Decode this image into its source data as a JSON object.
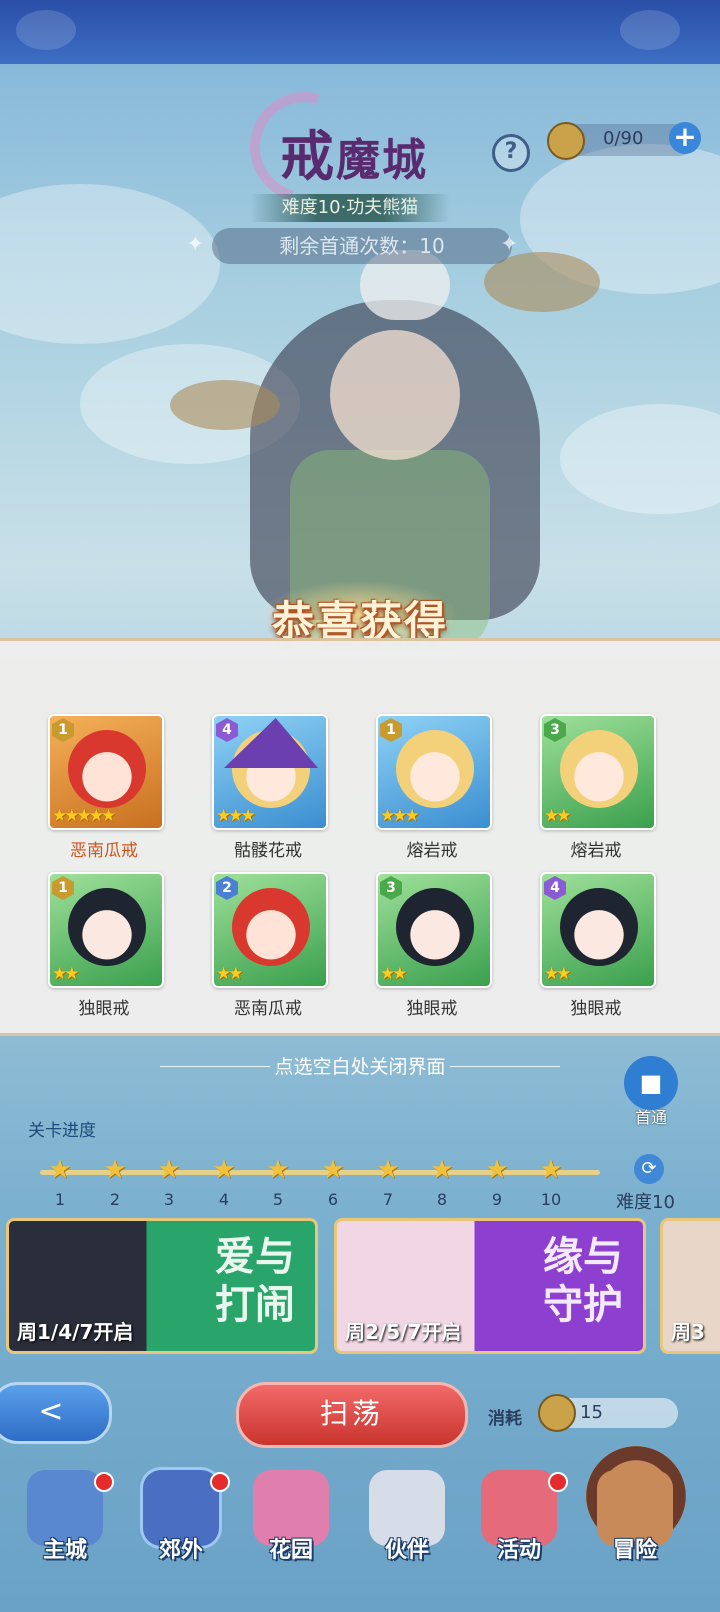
{
  "header": {
    "title_first": "戒",
    "title_rest": "魔城",
    "help_icon": "?",
    "stamina": "0/90",
    "stamina_plus": "+"
  },
  "stage": {
    "difficulty_label": "难度10·功夫熊猫",
    "remain_first_clears": "剩余首通次数：10"
  },
  "reward": {
    "banner": "恭喜获得",
    "items": [
      {
        "name": "恶南瓜戒",
        "level": "1",
        "stars": 5,
        "frame": "orange",
        "portrait": "red-demon-girl",
        "badge": "gold"
      },
      {
        "name": "骷髅花戒",
        "level": "4",
        "stars": 3,
        "frame": "blue",
        "portrait": "blonde-witch",
        "badge": "purple"
      },
      {
        "name": "熔岩戒",
        "level": "1",
        "stars": 3,
        "frame": "blue",
        "portrait": "blonde-girl",
        "badge": "gold"
      },
      {
        "name": "熔岩戒",
        "level": "3",
        "stars": 2,
        "frame": "green",
        "portrait": "blonde-girl",
        "badge": "green"
      },
      {
        "name": "独眼戒",
        "level": "1",
        "stars": 2,
        "frame": "green",
        "portrait": "black-hair-eyepatch",
        "badge": "gold"
      },
      {
        "name": "恶南瓜戒",
        "level": "2",
        "stars": 2,
        "frame": "green",
        "portrait": "red-demon-girl",
        "badge": "blue"
      },
      {
        "name": "独眼戒",
        "level": "3",
        "stars": 2,
        "frame": "green",
        "portrait": "black-hair-eyepatch",
        "badge": "green"
      },
      {
        "name": "独眼戒",
        "level": "4",
        "stars": 2,
        "frame": "green",
        "portrait": "black-hair-eyepatch",
        "badge": "purple"
      }
    ],
    "close_hint": "点选空白处关闭界面"
  },
  "side": {
    "first_clear_video": "首通"
  },
  "progress": {
    "label": "关卡进度",
    "nodes": [
      "1",
      "2",
      "3",
      "4",
      "5",
      "6",
      "7",
      "8",
      "9",
      "10"
    ],
    "difficulty": "难度10"
  },
  "events": [
    {
      "caption": "周1/4/7开启",
      "logo_line1": "爱与",
      "logo_line2": "打闹"
    },
    {
      "caption": "周2/5/7开启",
      "logo_line1": "缘与",
      "logo_line2": "守护"
    },
    {
      "caption": "周3"
    }
  ],
  "actions": {
    "back_icon": "<",
    "sweep": "扫荡",
    "cost_label": "消耗",
    "cost_value": "15"
  },
  "nav": [
    {
      "label": "主城",
      "icon": "castle-icon",
      "color": "#5a88d0",
      "dot": true
    },
    {
      "label": "郊外",
      "icon": "star-gate-icon",
      "color": "#4a6ec2",
      "dot": true
    },
    {
      "label": "花园",
      "icon": "heart-garden-icon",
      "color": "#e07fae",
      "dot": false
    },
    {
      "label": "伙伴",
      "icon": "partner-icon",
      "color": "#d6dce8",
      "dot": false
    },
    {
      "label": "活动",
      "icon": "gift-icon",
      "color": "#e56a7a",
      "dot": true
    },
    {
      "label": "冒险",
      "icon": "compass-icon",
      "color": "#c98a5a",
      "dot": false
    }
  ]
}
